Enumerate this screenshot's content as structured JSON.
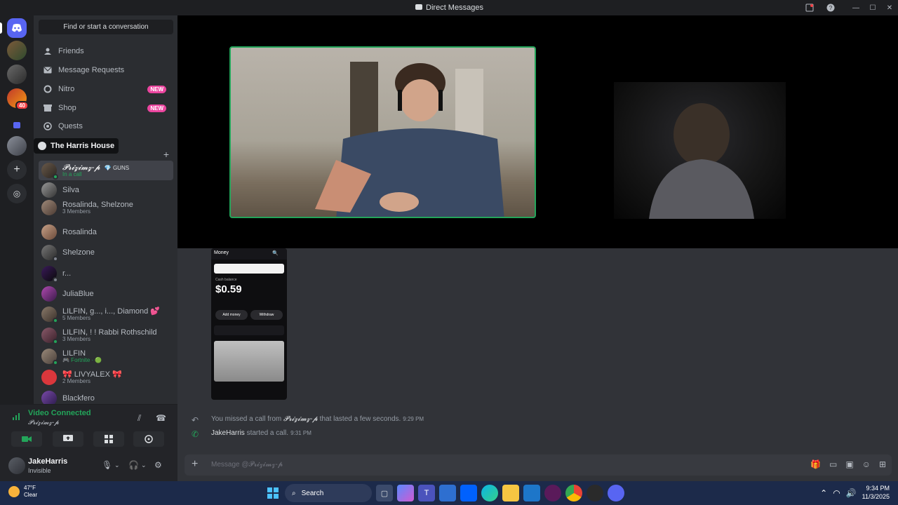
{
  "window": {
    "title": "Direct Messages"
  },
  "sidebar": {
    "search_placeholder": "Find or start a conversation",
    "nav": [
      {
        "label": "Friends",
        "icon": "friends-icon"
      },
      {
        "label": "Message Requests",
        "icon": "envelope-icon"
      },
      {
        "label": "Nitro",
        "icon": "nitro-icon",
        "badge": "NEW"
      },
      {
        "label": "Shop",
        "icon": "shop-icon",
        "badge": "NEW"
      },
      {
        "label": "Quests",
        "icon": "quests-icon"
      }
    ],
    "tooltip": "The Harris House",
    "server_badge": "40",
    "dms": [
      {
        "name": "𝓟𝓻𝓲𝔃𝓲𝓶𝔃-𝓹",
        "tag": "GUNS",
        "sub": "In a call",
        "active": true
      },
      {
        "name": "Silva"
      },
      {
        "name": "Rosalinda, Shelzone",
        "sub": "3 Members"
      },
      {
        "name": "Rosalinda"
      },
      {
        "name": "Shelzone"
      },
      {
        "name": "r..."
      },
      {
        "name": "JuliaBlue"
      },
      {
        "name": "LILFIN, g..., i..., Diamond 💕",
        "sub": "5 Members"
      },
      {
        "name": "LILFIN, ! ! Rabbi Rothschild",
        "sub": "3 Members"
      },
      {
        "name": "LILFIN",
        "sub": "🎮 Fortnite · 🟢"
      },
      {
        "name": "🎀 LIVYALEX 🎀",
        "sub": "2 Members"
      },
      {
        "name": "Blackfero"
      }
    ]
  },
  "voice": {
    "status": "Video Connected",
    "channel": "𝓟𝓻𝓲𝔃𝓲𝓶𝔃-𝓹"
  },
  "user": {
    "name": "JakeHarris",
    "status": "Invisible"
  },
  "attachment": {
    "app_title": "Money",
    "balance": "$0.59",
    "balance_label": "Cash balance",
    "btn1": "Add money",
    "btn2": "Withdraw"
  },
  "messages": [
    {
      "pre": "You missed a call from ",
      "who": "𝓟𝓻𝓲𝔃𝓲𝓶𝔃-𝓹",
      "post": " that lasted a few seconds.",
      "time": "9:29 PM"
    },
    {
      "who": "JakeHarris",
      "post": " started a call.",
      "time": "9:31 PM"
    }
  ],
  "composer": {
    "placeholder": "Message @𝓟𝓻𝓲𝔃𝓲𝓶𝔃-𝓹"
  },
  "taskbar": {
    "temp": "47°F",
    "cond": "Clear",
    "search": "Search",
    "time": "9:34 PM",
    "date": "11/3/2025"
  },
  "colors": {
    "accent": "#5865f2",
    "online": "#23a55a",
    "nitro_badge": "#eb459f"
  }
}
